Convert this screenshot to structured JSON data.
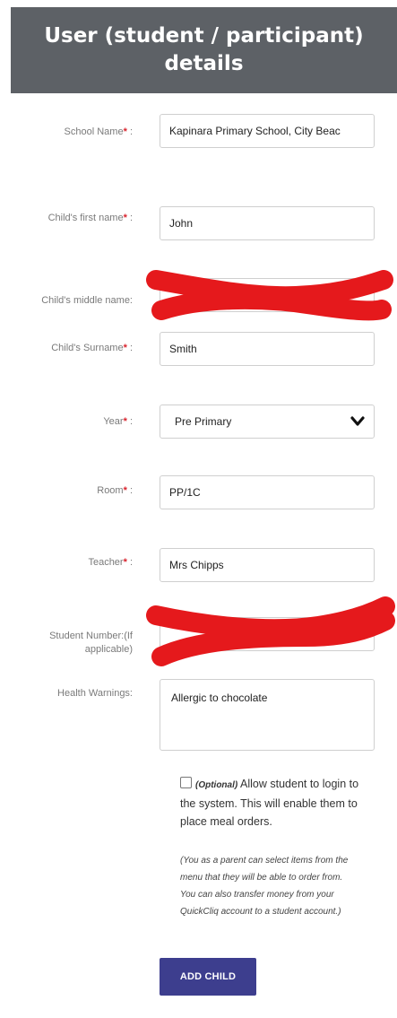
{
  "header": {
    "title": "User (student / participant) details"
  },
  "form": {
    "school_name": {
      "label": "School Name",
      "value": "Kapinara Primary School, City Beac"
    },
    "first_name": {
      "label": "Child's first name",
      "value": "John"
    },
    "middle_name": {
      "label": "Child's middle name:",
      "value": ""
    },
    "surname": {
      "label": "Child's Surname",
      "value": "Smith"
    },
    "year": {
      "label": "Year",
      "value": "Pre Primary"
    },
    "room": {
      "label": "Room",
      "value": "PP/1C"
    },
    "teacher": {
      "label": "Teacher",
      "value": "Mrs Chipps"
    },
    "student_number": {
      "label": "Student Number:(If applicable)",
      "value": ""
    },
    "health": {
      "label": "Health Warnings:",
      "value": "Allergic to chocolate"
    },
    "required_mark": "*",
    "label_suffix": ":"
  },
  "login_option": {
    "optional_tag": "(Optional)",
    "text": "Allow student to login to the system. This will enable them to place meal orders.",
    "note": "(You as a parent can select items from the menu that they will be able to order from. You can also transfer money from your QuickCliq account to a student account.)"
  },
  "actions": {
    "add_child_label": "ADD CHILD"
  },
  "colors": {
    "header_bg": "#5d6166",
    "required": "#d9232d",
    "button_bg": "#3d3e8e",
    "redaction": "#e5191c"
  },
  "icons": {
    "select": "chevron-down-icon",
    "checkbox": "checkbox-icon"
  }
}
